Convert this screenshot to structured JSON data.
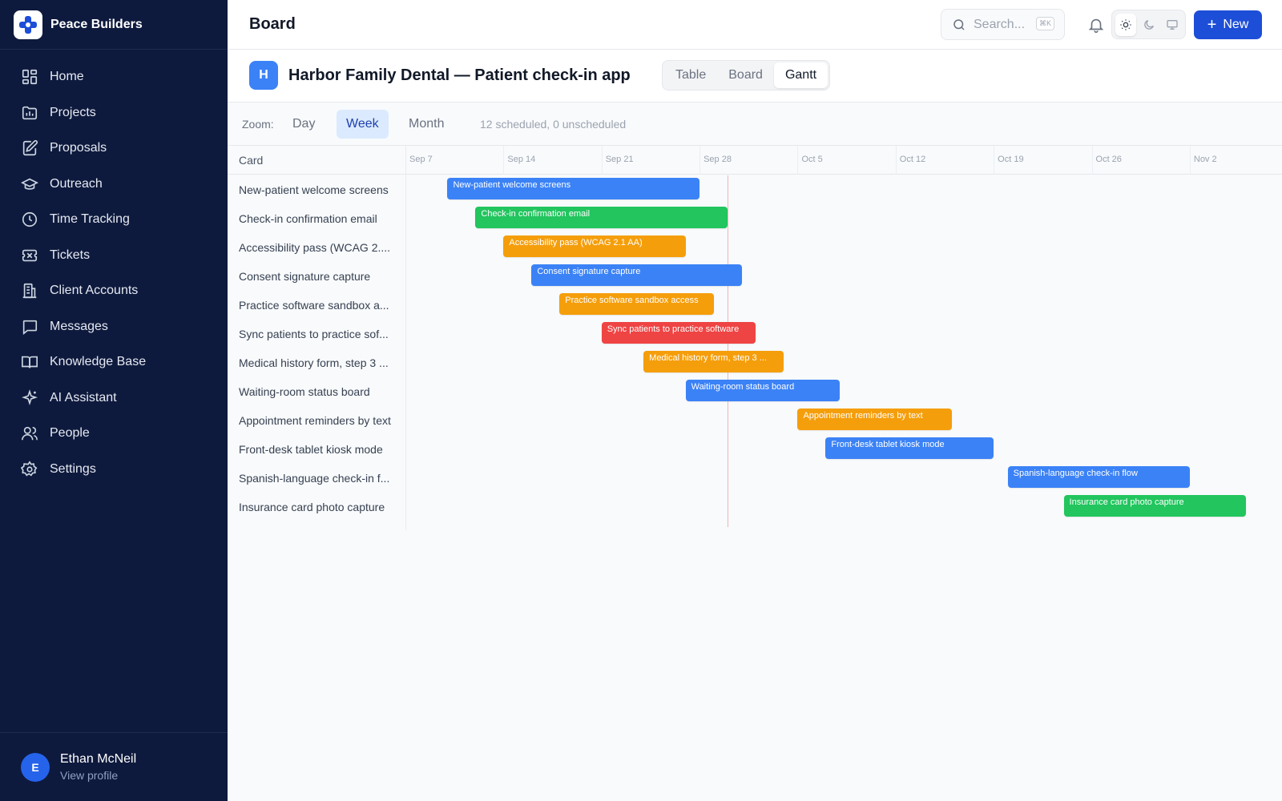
{
  "brand": {
    "name": "Peace Builders"
  },
  "sidebar": {
    "items": [
      {
        "label": "Home",
        "icon": "home-grid-icon"
      },
      {
        "label": "Projects",
        "icon": "projects-icon"
      },
      {
        "label": "Proposals",
        "icon": "proposals-icon"
      },
      {
        "label": "Outreach",
        "icon": "outreach-icon"
      },
      {
        "label": "Time Tracking",
        "icon": "clock-icon"
      },
      {
        "label": "Tickets",
        "icon": "ticket-icon"
      },
      {
        "label": "Client Accounts",
        "icon": "building-icon"
      },
      {
        "label": "Messages",
        "icon": "message-icon"
      },
      {
        "label": "Knowledge Base",
        "icon": "book-icon"
      },
      {
        "label": "AI Assistant",
        "icon": "sparkle-icon"
      },
      {
        "label": "People",
        "icon": "people-icon"
      },
      {
        "label": "Settings",
        "icon": "gear-icon"
      }
    ]
  },
  "profile": {
    "initial": "E",
    "name": "Ethan McNeil",
    "link": "View profile"
  },
  "header": {
    "title": "Board",
    "search_placeholder": "Search...",
    "shortcut": "⌘K",
    "new_label": "New"
  },
  "project": {
    "initial": "H",
    "title": "Harbor Family Dental — Patient check-in app",
    "tabs": [
      "Table",
      "Board",
      "Gantt"
    ],
    "active_tab": "Gantt"
  },
  "zoom": {
    "label": "Zoom:",
    "options": [
      "Day",
      "Week",
      "Month"
    ],
    "active": "Week",
    "status": "12 scheduled, 0 unscheduled"
  },
  "gantt": {
    "column_header": "Card",
    "week_labels": [
      "Sep 7",
      "Sep 14",
      "Sep 21",
      "Sep 28",
      "Oct 5",
      "Oct 12",
      "Oct 19",
      "Oct 26",
      "Nov 2"
    ],
    "today": "Sep 30",
    "colors": {
      "blue": "#3b82f6",
      "green": "#22c55e",
      "orange": "#f59e0b",
      "red": "#ef4444"
    },
    "tasks": [
      {
        "label": "New-patient welcome screens",
        "bar": "New-patient welcome screens",
        "start": "Sep 10",
        "end": "Sep 28",
        "color": "blue"
      },
      {
        "label": "Check-in confirmation email",
        "bar": "Check-in confirmation email",
        "start": "Sep 12",
        "end": "Sep 30",
        "color": "green"
      },
      {
        "label": "Accessibility pass (WCAG 2....",
        "bar": "Accessibility pass (WCAG 2.1 AA)",
        "start": "Sep 14",
        "end": "Sep 27",
        "color": "orange"
      },
      {
        "label": "Consent signature capture",
        "bar": "Consent signature capture",
        "start": "Sep 16",
        "end": "Oct 1",
        "color": "blue"
      },
      {
        "label": "Practice software sandbox a...",
        "bar": "Practice software sandbox access",
        "start": "Sep 18",
        "end": "Sep 29",
        "color": "orange"
      },
      {
        "label": "Sync patients to practice sof...",
        "bar": "Sync patients to practice software",
        "start": "Sep 21",
        "end": "Oct 2",
        "color": "red"
      },
      {
        "label": "Medical history form, step 3 ...",
        "bar": "Medical history form, step 3 ...",
        "start": "Sep 24",
        "end": "Oct 4",
        "color": "orange"
      },
      {
        "label": "Waiting-room status board",
        "bar": "Waiting-room status board",
        "start": "Sep 27",
        "end": "Oct 8",
        "color": "blue"
      },
      {
        "label": "Appointment reminders by text",
        "bar": "Appointment reminders by text",
        "start": "Oct 5",
        "end": "Oct 16",
        "color": "orange"
      },
      {
        "label": "Front-desk tablet kiosk mode",
        "bar": "Front-desk tablet kiosk mode",
        "start": "Oct 7",
        "end": "Oct 19",
        "color": "blue"
      },
      {
        "label": "Spanish-language check-in f...",
        "bar": "Spanish-language check-in flow",
        "start": "Oct 20",
        "end": "Nov 2",
        "color": "blue"
      },
      {
        "label": "Insurance card photo capture",
        "bar": "Insurance card photo capture",
        "start": "Oct 24",
        "end": "Nov 6",
        "color": "green"
      }
    ]
  }
}
